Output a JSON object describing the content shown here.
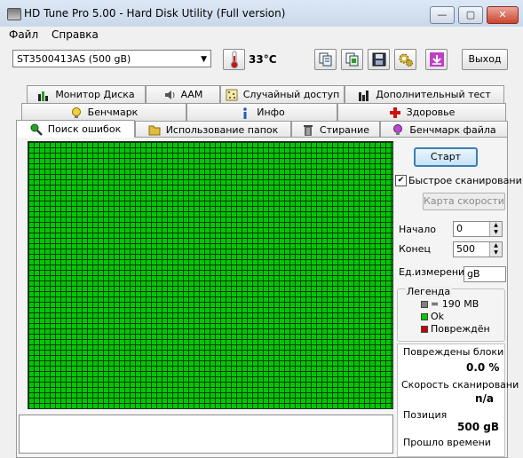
{
  "window": {
    "title": "HD Tune Pro 5.00 - Hard Disk Utility (Full  version)",
    "buttons": {
      "minimize": "—",
      "maximize": "▢",
      "close": "✕"
    }
  },
  "menu": {
    "file": "Файл",
    "help": "Справка"
  },
  "toolbar": {
    "drive": "ST3500413AS (500 gB)",
    "temperature": "33°C",
    "exit_label": "Выход"
  },
  "tabs": {
    "row1": [
      "Монитор Диска",
      "AAM",
      "Случайный доступ",
      "Дополнительный  тест"
    ],
    "row2": [
      "Бенчмарк",
      "Инфо",
      "Здоровье"
    ],
    "row3": [
      "Поиск ошибок",
      "Использование папок",
      "Стирание",
      "Бенчмарк файла"
    ],
    "active": "Поиск ошибок"
  },
  "scan": {
    "start_label": "Старт",
    "quick_scan_label": "Быстрое сканировани",
    "quick_scan_checked": true,
    "speed_map_label": "Карта скорости",
    "start_field_label": "Начало",
    "start_value": "0",
    "end_field_label": "Конец",
    "end_value": "500",
    "unit_label": "Ед.измерения",
    "unit_value": "gB"
  },
  "legend": {
    "title": "Легенда",
    "block_size": "= 190 MB",
    "ok": "Ok",
    "damaged": "Повреждён",
    "colors": {
      "block": "#808080",
      "ok": "#00c800",
      "damaged": "#c80000"
    }
  },
  "stats": {
    "damaged_label": "Повреждены блоки",
    "damaged_value": "0.0 %",
    "speed_label": "Скорость сканировани",
    "speed_value": "n/a",
    "position_label": "Позиция",
    "position_value": "500 gB",
    "elapsed_label": "Прошло времени"
  }
}
